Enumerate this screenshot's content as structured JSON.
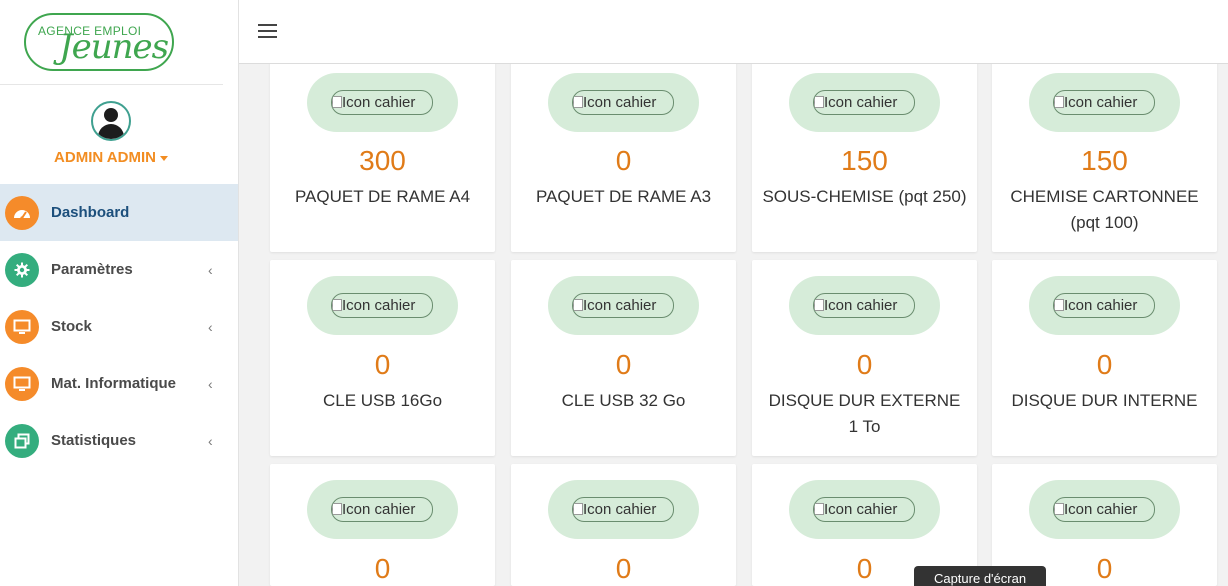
{
  "logo": {
    "small": "AGENCE EMPLOI",
    "big": "Jeunes"
  },
  "user": {
    "name": "ADMIN ADMIN"
  },
  "nav": [
    {
      "label": "Dashboard",
      "icon": "dashboard-gauge-icon",
      "color": "#f58b2a",
      "active": true
    },
    {
      "label": "Paramètres",
      "icon": "gear-icon",
      "color": "#34ad7e"
    },
    {
      "label": "Stock",
      "icon": "monitor-icon",
      "color": "#f58b2a"
    },
    {
      "label": "Mat. Informatique",
      "icon": "monitor-icon",
      "color": "#f58b2a"
    },
    {
      "label": "Statistiques",
      "icon": "windows-stack-icon",
      "color": "#34ad7e"
    }
  ],
  "nav_chevron": "‹",
  "cards": [
    {
      "alt": "Icon cahier",
      "count": "300",
      "label": "PAQUET DE RAME A4"
    },
    {
      "alt": "Icon cahier",
      "count": "0",
      "label": "PAQUET DE RAME A3"
    },
    {
      "alt": "Icon cahier",
      "count": "150",
      "label": "SOUS-CHEMISE (pqt 250)"
    },
    {
      "alt": "Icon cahier",
      "count": "150",
      "label": "CHEMISE CARTONNEE (pqt 100)"
    },
    {
      "alt": "Icon cahier",
      "count": "0",
      "label": "CLE USB 16Go"
    },
    {
      "alt": "Icon cahier",
      "count": "0",
      "label": "CLE USB 32 Go"
    },
    {
      "alt": "Icon cahier",
      "count": "0",
      "label": "DISQUE DUR EXTERNE 1 To"
    },
    {
      "alt": "Icon cahier",
      "count": "0",
      "label": "DISQUE DUR INTERNE"
    },
    {
      "alt": "Icon cahier",
      "count": "0",
      "label": ""
    },
    {
      "alt": "Icon cahier",
      "count": "0",
      "label": ""
    },
    {
      "alt": "Icon cahier",
      "count": "0",
      "label": ""
    },
    {
      "alt": "Icon cahier",
      "count": "0",
      "label": ""
    }
  ],
  "tooltip": "Capture d'écran",
  "colors": {
    "accent_orange": "#e07b18",
    "brand_green": "#3fa64f",
    "pill_green": "#d6ecd9",
    "active_nav_bg": "#dde8f1"
  }
}
